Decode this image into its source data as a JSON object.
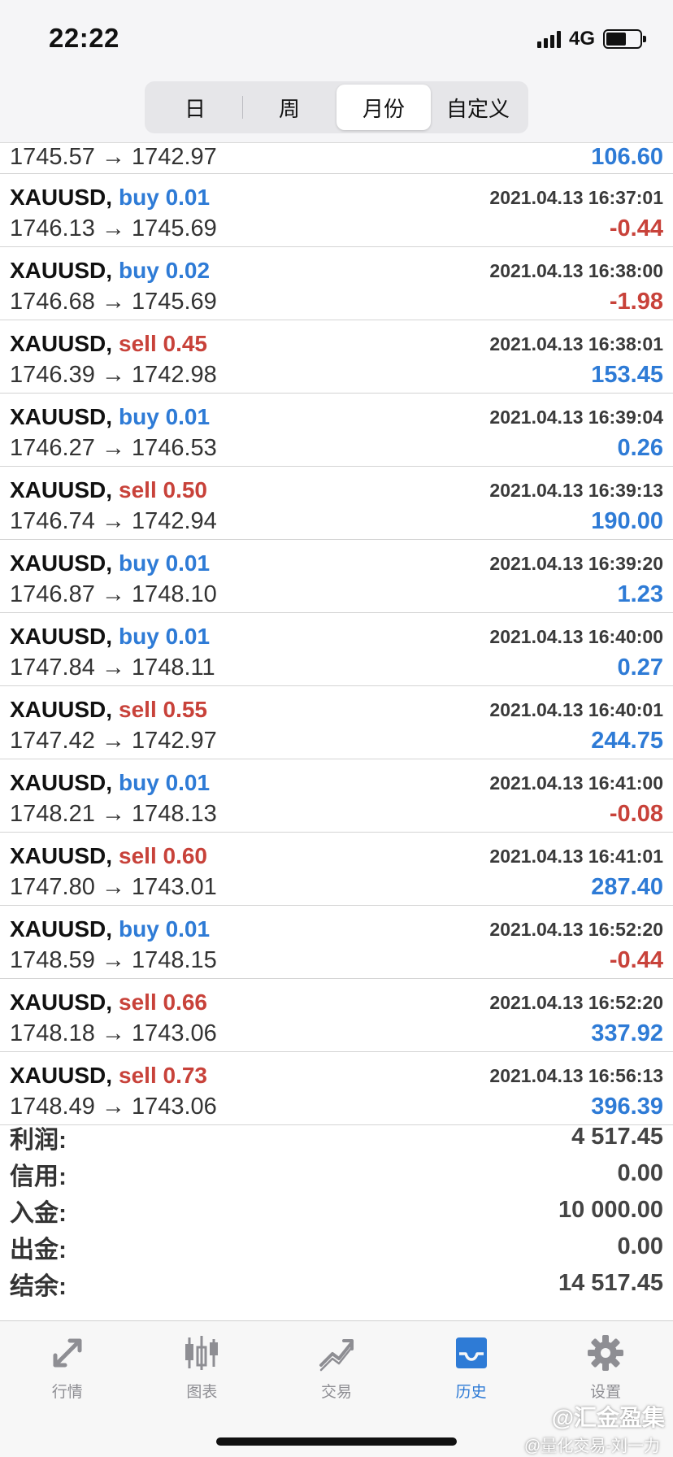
{
  "status_bar": {
    "time": "22:22",
    "network": "4G"
  },
  "period_tabs": [
    {
      "label": "日",
      "active": false
    },
    {
      "label": "周",
      "active": false
    },
    {
      "label": "月份",
      "active": true
    },
    {
      "label": "自定义",
      "active": false
    }
  ],
  "partial_row": {
    "prices": "1745.57 → 1742.97",
    "profit": "106.60"
  },
  "trades": [
    {
      "symbol": "XAUUSD,",
      "side": "buy 0.01",
      "time": "2021.04.13 16:37:01",
      "prices": "1746.13 → 1745.69",
      "profit": "-0.44"
    },
    {
      "symbol": "XAUUSD,",
      "side": "buy 0.02",
      "time": "2021.04.13 16:38:00",
      "prices": "1746.68 → 1745.69",
      "profit": "-1.98"
    },
    {
      "symbol": "XAUUSD,",
      "side": "sell 0.45",
      "time": "2021.04.13 16:38:01",
      "prices": "1746.39 → 1742.98",
      "profit": "153.45"
    },
    {
      "symbol": "XAUUSD,",
      "side": "buy 0.01",
      "time": "2021.04.13 16:39:04",
      "prices": "1746.27 → 1746.53",
      "profit": "0.26"
    },
    {
      "symbol": "XAUUSD,",
      "side": "sell 0.50",
      "time": "2021.04.13 16:39:13",
      "prices": "1746.74 → 1742.94",
      "profit": "190.00"
    },
    {
      "symbol": "XAUUSD,",
      "side": "buy 0.01",
      "time": "2021.04.13 16:39:20",
      "prices": "1746.87 → 1748.10",
      "profit": "1.23"
    },
    {
      "symbol": "XAUUSD,",
      "side": "buy 0.01",
      "time": "2021.04.13 16:40:00",
      "prices": "1747.84 → 1748.11",
      "profit": "0.27"
    },
    {
      "symbol": "XAUUSD,",
      "side": "sell 0.55",
      "time": "2021.04.13 16:40:01",
      "prices": "1747.42 → 1742.97",
      "profit": "244.75"
    },
    {
      "symbol": "XAUUSD,",
      "side": "buy 0.01",
      "time": "2021.04.13 16:41:00",
      "prices": "1748.21 → 1748.13",
      "profit": "-0.08"
    },
    {
      "symbol": "XAUUSD,",
      "side": "sell 0.60",
      "time": "2021.04.13 16:41:01",
      "prices": "1747.80 → 1743.01",
      "profit": "287.40"
    },
    {
      "symbol": "XAUUSD,",
      "side": "buy 0.01",
      "time": "2021.04.13 16:52:20",
      "prices": "1748.59 → 1748.15",
      "profit": "-0.44"
    },
    {
      "symbol": "XAUUSD,",
      "side": "sell 0.66",
      "time": "2021.04.13 16:52:20",
      "prices": "1748.18 → 1743.06",
      "profit": "337.92"
    },
    {
      "symbol": "XAUUSD,",
      "side": "sell 0.73",
      "time": "2021.04.13 16:56:13",
      "prices": "1748.49 → 1743.06",
      "profit": "396.39"
    }
  ],
  "summary": [
    {
      "label": "利润:",
      "value": "4 517.45"
    },
    {
      "label": "信用:",
      "value": "0.00"
    },
    {
      "label": "入金:",
      "value": "10 000.00"
    },
    {
      "label": "出金:",
      "value": "0.00"
    },
    {
      "label": "结余:",
      "value": "14 517.45"
    }
  ],
  "colors": {
    "buy": "#2e7bd6",
    "sell": "#c8423a",
    "active_tab": "#2e7bd6",
    "inactive_tab": "#8e8e93"
  },
  "tabbar": [
    {
      "label": "行情",
      "icon": "quotes-arrows-icon",
      "active": false
    },
    {
      "label": "图表",
      "icon": "candlestick-chart-icon",
      "active": false
    },
    {
      "label": "交易",
      "icon": "trade-trend-icon",
      "active": false
    },
    {
      "label": "历史",
      "icon": "history-inbox-icon",
      "active": true
    },
    {
      "label": "设置",
      "icon": "gear-icon",
      "active": false
    }
  ],
  "watermark": {
    "line1": "@汇金盈集",
    "line2": "@量化交易-刘一力"
  }
}
